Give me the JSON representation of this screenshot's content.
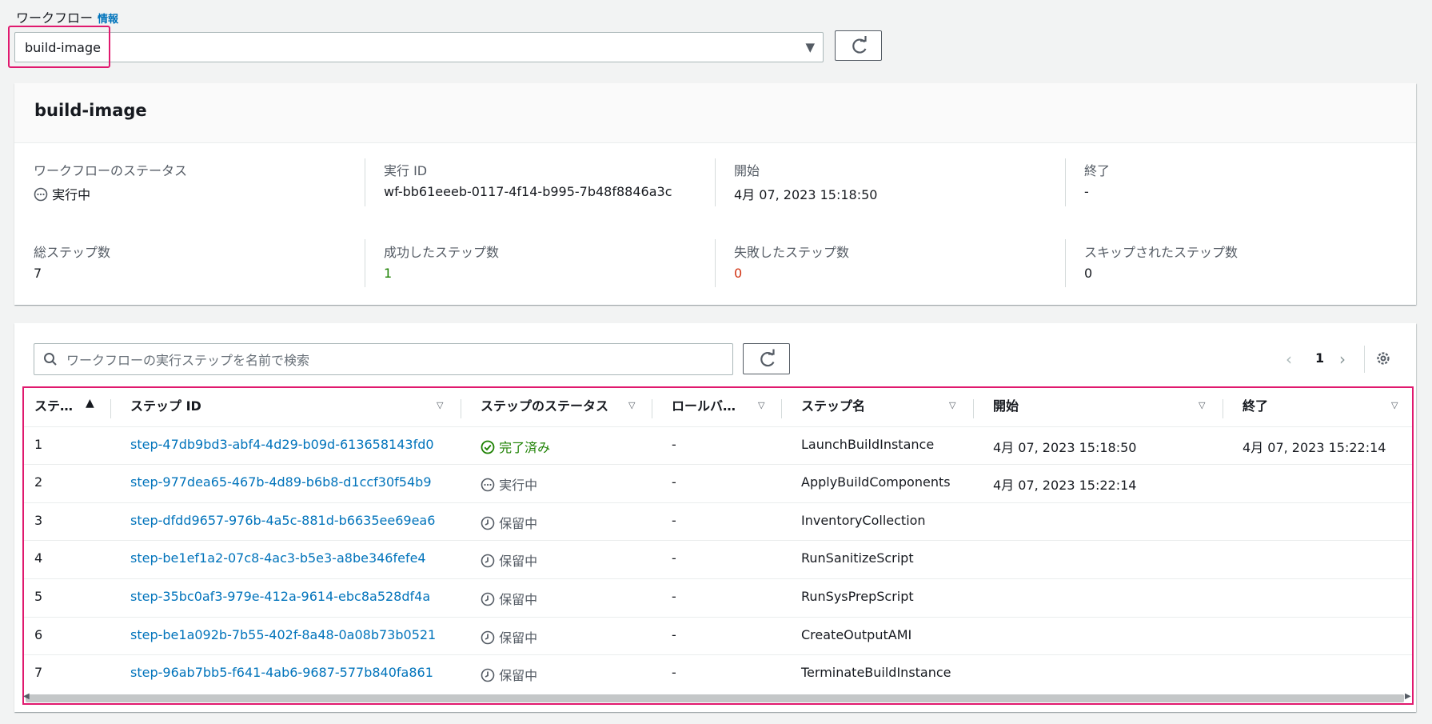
{
  "workflow": {
    "label": "ワークフロー",
    "info_link": "情報",
    "selected": "build-image"
  },
  "summary": {
    "title": "build-image",
    "fields": [
      {
        "label": "ワークフローのステータス",
        "value": "実行中",
        "icon": "in-progress-icon"
      },
      {
        "label": "実行 ID",
        "value": "wf-bb61eeeb-0117-4f14-b995-7b48f8846a3c"
      },
      {
        "label": "開始",
        "value": "4月 07, 2023 15:18:50"
      },
      {
        "label": "終了",
        "value": "-"
      },
      {
        "label": "総ステップ数",
        "value": "7"
      },
      {
        "label": "成功したステップ数",
        "value": "1",
        "color": "#1d8102"
      },
      {
        "label": "失敗したステップ数",
        "value": "0",
        "color": "#d13212"
      },
      {
        "label": "スキップされたステップ数",
        "value": "0"
      }
    ]
  },
  "steps": {
    "search_placeholder": "ワークフローの実行ステップを名前で検索",
    "page": "1",
    "columns": [
      "ステ…",
      "ステップ ID",
      "ステップのステータス",
      "ロールバ…",
      "ステップ名",
      "開始",
      "終了"
    ],
    "rows": [
      {
        "num": "1",
        "id": "step-47db9bd3-abf4-4d29-b09d-613658143fd0",
        "status": "完了済み",
        "status_icon": "check-circle-icon",
        "rollback": "-",
        "name": "LaunchBuildInstance",
        "start": "4月 07, 2023 15:18:50",
        "end": "4月 07, 2023 15:22:14"
      },
      {
        "num": "2",
        "id": "step-977dea65-467b-4d89-b6b8-d1ccf30f54b9",
        "status": "実行中",
        "status_icon": "in-progress-icon",
        "rollback": "-",
        "name": "ApplyBuildComponents",
        "start": "4月 07, 2023 15:22:14",
        "end": ""
      },
      {
        "num": "3",
        "id": "step-dfdd9657-976b-4a5c-881d-b6635ee69ea6",
        "status": "保留中",
        "status_icon": "clock-icon",
        "rollback": "-",
        "name": "InventoryCollection",
        "start": "",
        "end": ""
      },
      {
        "num": "4",
        "id": "step-be1ef1a2-07c8-4ac3-b5e3-a8be346fefe4",
        "status": "保留中",
        "status_icon": "clock-icon",
        "rollback": "-",
        "name": "RunSanitizeScript",
        "start": "",
        "end": ""
      },
      {
        "num": "5",
        "id": "step-35bc0af3-979e-412a-9614-ebc8a528df4a",
        "status": "保留中",
        "status_icon": "clock-icon",
        "rollback": "-",
        "name": "RunSysPrepScript",
        "start": "",
        "end": ""
      },
      {
        "num": "6",
        "id": "step-be1a092b-7b55-402f-8a48-0a08b73b0521",
        "status": "保留中",
        "status_icon": "clock-icon",
        "rollback": "-",
        "name": "CreateOutputAMI",
        "start": "",
        "end": ""
      },
      {
        "num": "7",
        "id": "step-96ab7bb5-f641-4ab6-9687-577b840fa861",
        "status": "保留中",
        "status_icon": "clock-icon",
        "rollback": "-",
        "name": "TerminateBuildInstance",
        "start": "",
        "end": ""
      }
    ]
  },
  "colors": {
    "link": "#0073bb",
    "success": "#1d8102",
    "error": "#d13212",
    "highlight": "#e0196e"
  }
}
